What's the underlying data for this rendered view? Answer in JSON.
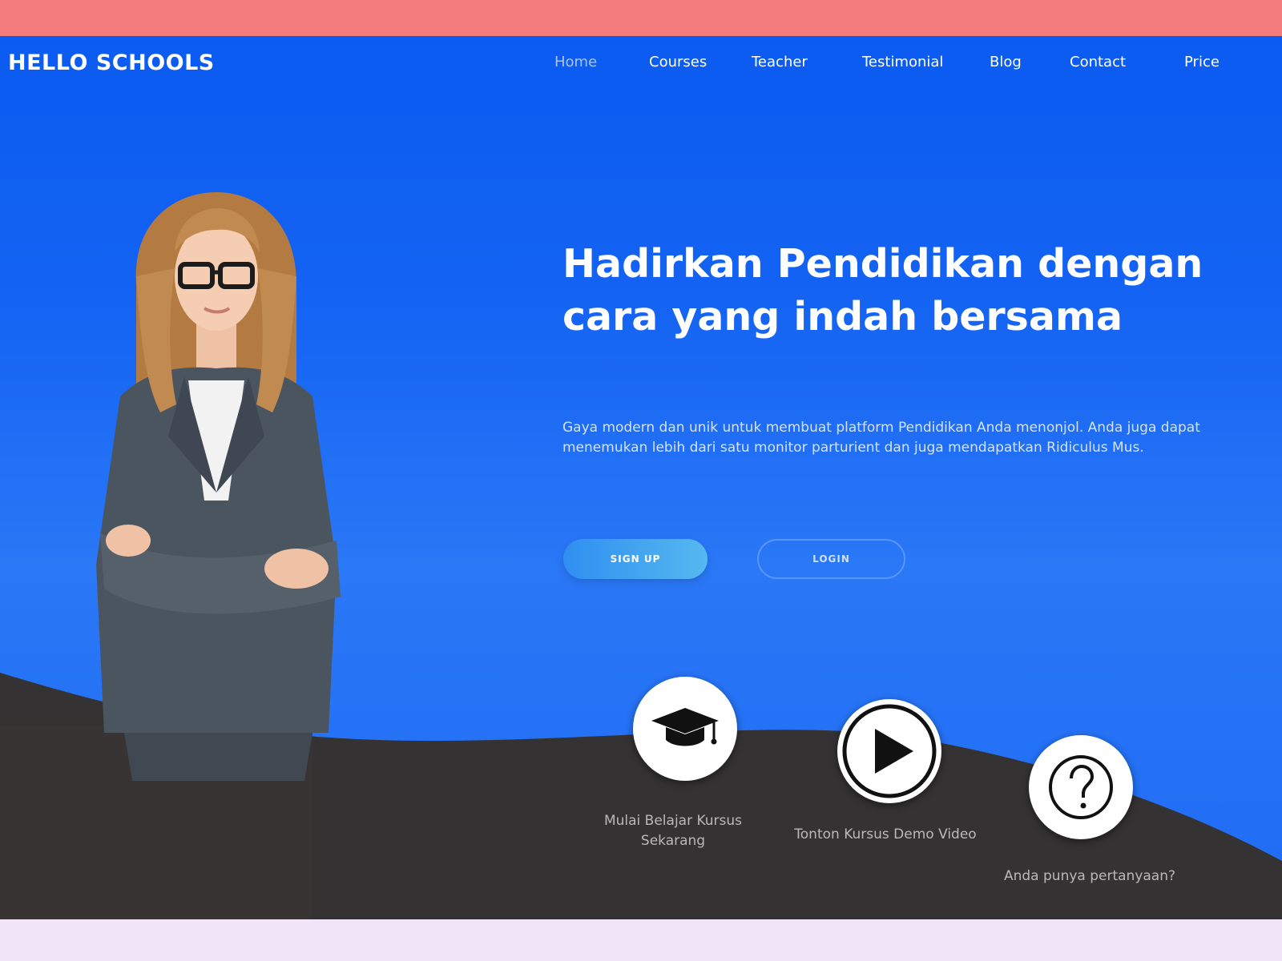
{
  "header": {
    "logo": "HELLO SCHOOLS",
    "nav": [
      "Home",
      "Courses",
      "Teacher",
      "Testimonial",
      "Blog",
      "Contact",
      "Price"
    ],
    "active_nav": "Home"
  },
  "hero": {
    "headline_line1": "Hadirkan Pendidikan dengan",
    "headline_line2": "cara yang indah bersama",
    "description": "Gaya modern dan unik untuk membuat platform Pendidikan Anda menonjol. Anda juga dapat menemukan lebih dari satu monitor parturient dan juga mendapatkan Ridiculus Mus.",
    "primary_button": "SIGN UP",
    "secondary_button": "LOGIN"
  },
  "features": [
    {
      "icon": "graduation-cap-icon",
      "label": "Mulai Belajar Kursus Sekarang"
    },
    {
      "icon": "play-icon",
      "label": "Tonton Kursus Demo Video"
    },
    {
      "icon": "question-icon",
      "label": "Anda punya pertanyaan?"
    }
  ],
  "colors": {
    "top_strip": "#f47b7b",
    "hero_blue": "#1463f3",
    "dark_wave": "#343232",
    "bottom_strip": "#f1e4f6"
  }
}
